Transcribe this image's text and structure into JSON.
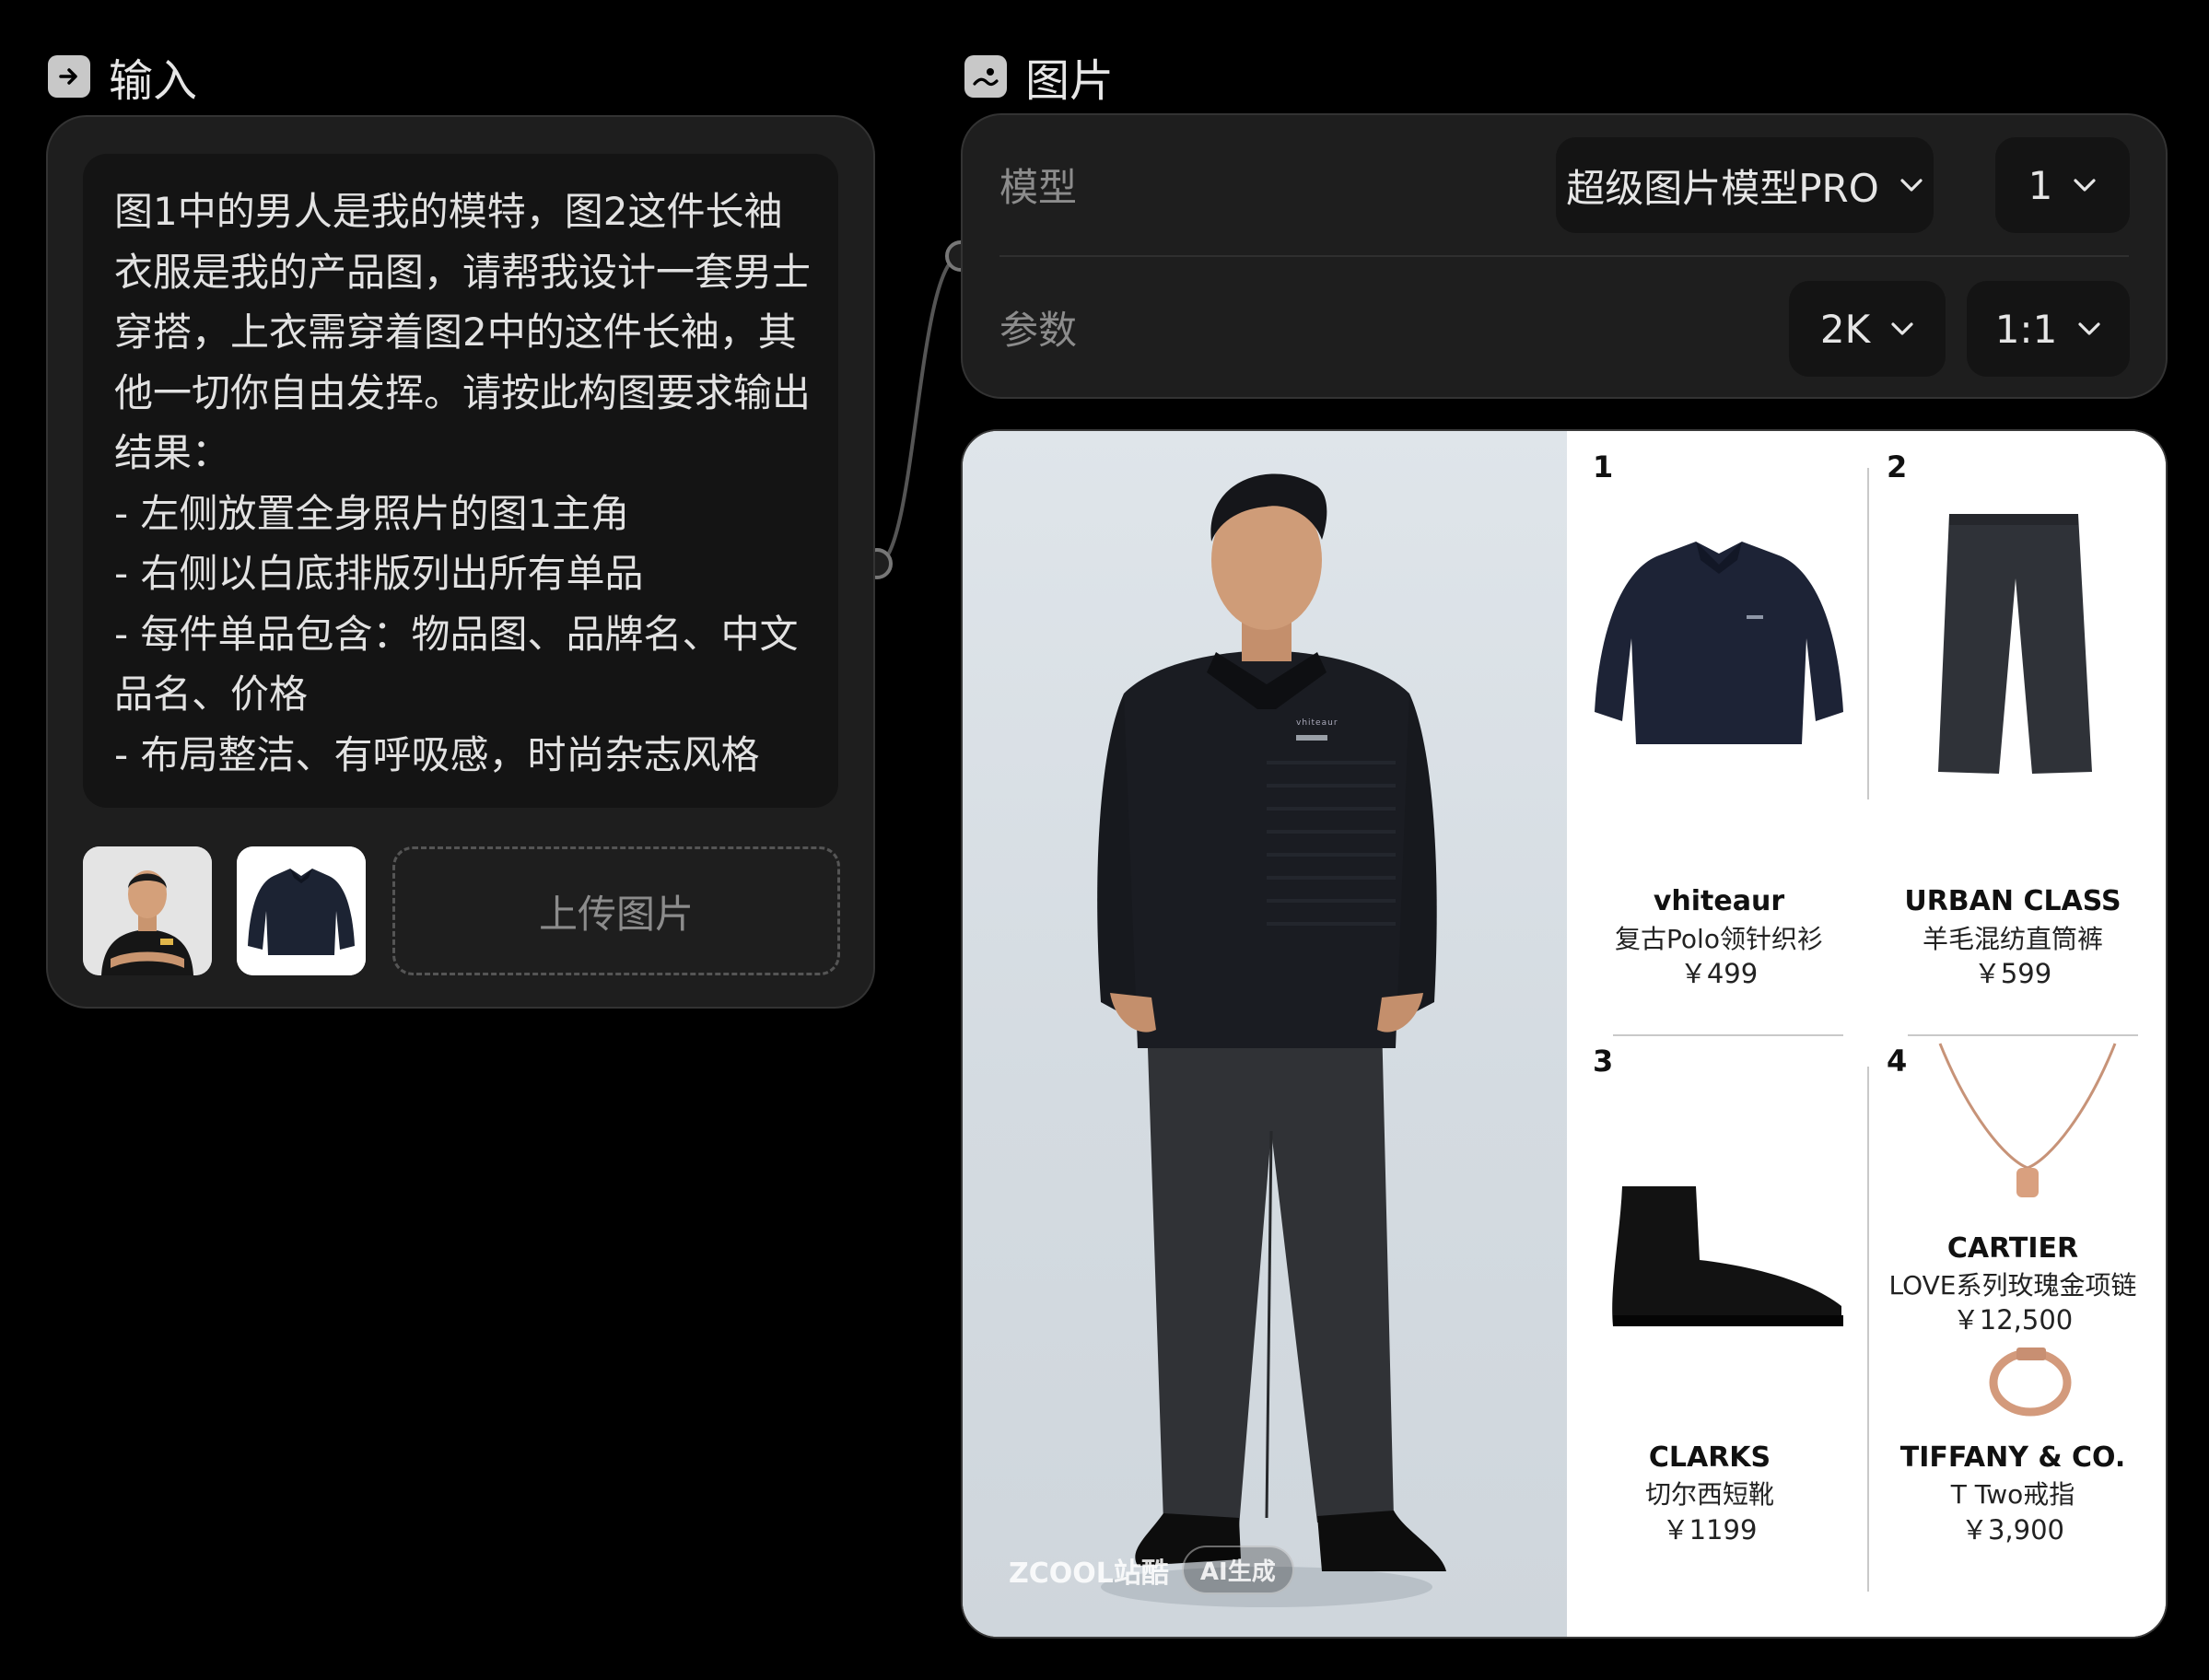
{
  "input_section": {
    "title": "输入",
    "icon": "arrow-right-box-icon"
  },
  "image_section": {
    "title": "图片",
    "icon": "image-icon"
  },
  "prompt": {
    "lines": [
      "图1中的男人是我的模特，图2这件长袖",
      "衣服是我的产品图，请帮我设计一套男士",
      "穿搭，上衣需穿着图2中的这件长袖，其",
      "他一切你自由发挥。请按此构图要求输出",
      "结果：",
      "- 左侧放置全身照片的图1主角",
      "- 右侧以白底排版列出所有单品",
      "- 每件单品包含：物品图、品牌名、中文",
      "品名、价格",
      "- 布局整洁、有呼吸感，时尚杂志风格"
    ]
  },
  "upload": {
    "label": "上传图片"
  },
  "settings": {
    "model_label": "模型",
    "model_value": "超级图片模型PRO",
    "count_value": "1",
    "params_label": "参数",
    "resolution_value": "2K",
    "ratio_value": "1:1"
  },
  "result": {
    "watermark_brand": "ZCOOL站酷",
    "watermark_ai": "AI生成",
    "sweater_logo": "vhiteaur",
    "items": [
      {
        "num": "1",
        "brand": "vhiteaur",
        "name": "复古Polo领针织衫",
        "price": "￥499"
      },
      {
        "num": "2",
        "brand": "URBAN CLASS",
        "name": "羊毛混纺直筒裤",
        "price": "￥599"
      },
      {
        "num": "3",
        "brand": "CLARKS",
        "name": "切尔西短靴",
        "price": "￥1199"
      },
      {
        "num": "4",
        "brand": "CARTIER",
        "name": "LOVE系列玫瑰金项链",
        "price": "￥12,500"
      },
      {
        "num": "",
        "brand": "TIFFANY & CO.",
        "name": "T Two戒指",
        "price": "￥3,900"
      }
    ]
  },
  "colors": {
    "background": "#000000",
    "panel": "#1e1e1e",
    "field": "#141414",
    "muted_text": "#8c8c8c"
  }
}
